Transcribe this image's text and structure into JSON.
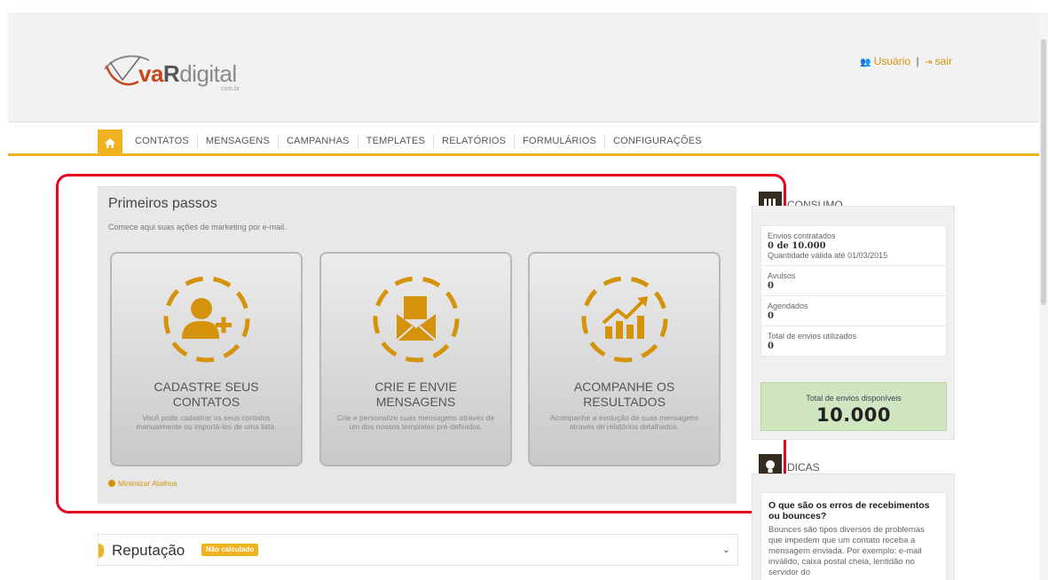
{
  "header": {
    "logo_brand_v": "va",
    "logo_brand_r": "R",
    "logo_brand_rest": "digital",
    "logo_suffix": ".com.br",
    "user_link": "Usuário",
    "separator": "|",
    "logout_link": "sair"
  },
  "nav": {
    "home_icon": "home-icon",
    "items": [
      "CONTATOS",
      "MENSAGENS",
      "CAMPANHAS",
      "TEMPLATES",
      "RELATÓRIOS",
      "FORMULÁRIOS",
      "CONFIGURAÇÕES"
    ]
  },
  "first_steps": {
    "title": "Primeiros passos",
    "subtitle": "Comece aqui suas ações de marketing por e-mail.",
    "cards": [
      {
        "icon": "add-user-icon",
        "title": "CADASTRE SEUS CONTATOS",
        "description": "Você pode cadastrar os seus contatos manualmente ou importá-los de uma lista."
      },
      {
        "icon": "envelope-icon",
        "title": "CRIE E ENVIE MENSAGENS",
        "description": "Crie e personalize suas mensagens através de um dos nossos templates pré-definidos."
      },
      {
        "icon": "chart-growth-icon",
        "title": "ACOMPANHE OS RESULTADOS",
        "description": "Acompanhe a evolução de suas mensagens através de relatórios detalhados."
      }
    ],
    "minimize_link": "Minimizar Atalhos"
  },
  "reputation": {
    "title": "Reputação",
    "badge": "Não calculado"
  },
  "consumption": {
    "title": "CONSUMO",
    "contracted_label": "Envios contratados",
    "contracted_value": "0 de 10.000",
    "validity": "Quantidade válida até 01/03/2015",
    "avulsos_label": "Avulsos",
    "avulsos_value": "0",
    "scheduled_label": "Agendados",
    "scheduled_value": "0",
    "used_label": "Total de envios utilizados",
    "used_value": "0",
    "available_label": "Total de envios disponíveis",
    "available_value": "10.000"
  },
  "tips": {
    "title": "DICAS",
    "question": "O que são os erros de recebimentos ou bounces?",
    "text": "Bounces são tipos diversos de problemas que impedem que um contato receba a mensagem enviada. Por exemplo: e-mail inválido, caixa postal cheia, lentidão no servidor do"
  },
  "colors": {
    "accent": "#f0b21f",
    "icon_gold": "#d4930a",
    "highlight": "#e8001c",
    "available_bg": "#cfe6c0"
  }
}
